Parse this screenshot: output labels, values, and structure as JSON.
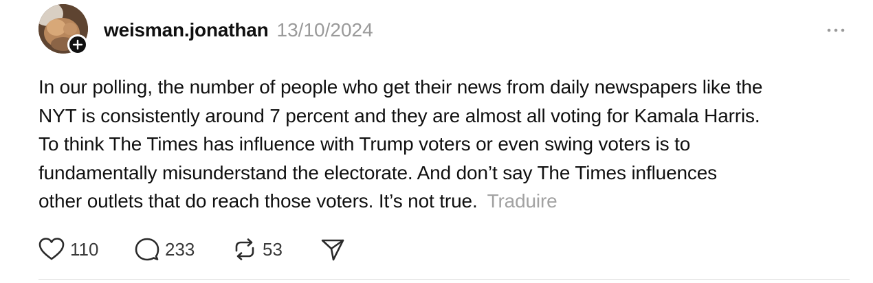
{
  "post": {
    "username": "weisman.jonathan",
    "timestamp": "13/10/2024",
    "body_lines": [
      "In our polling, the number of people who get their news from daily newspapers like the",
      "NYT is consistently around 7 percent and they are almost all voting for Kamala Harris.",
      "To think The Times has influence with Trump voters or even swing voters is to",
      "fundamentally misunderstand the electorate. And don’t say The Times influences",
      "other outlets that do reach those voters. It’s not true."
    ],
    "translate_label": "Traduire",
    "stats": {
      "likes": "110",
      "replies": "233",
      "reposts": "53"
    }
  },
  "icons": {
    "avatar": "profile-photo",
    "follow": "plus-icon",
    "more": "more-horizontal-icon",
    "like": "heart-icon",
    "reply": "speech-bubble-icon",
    "repost": "repost-icon",
    "share": "paper-plane-icon"
  },
  "colors": {
    "text": "#101010",
    "muted": "#9a9a9a",
    "divider": "#dcdcdc"
  }
}
